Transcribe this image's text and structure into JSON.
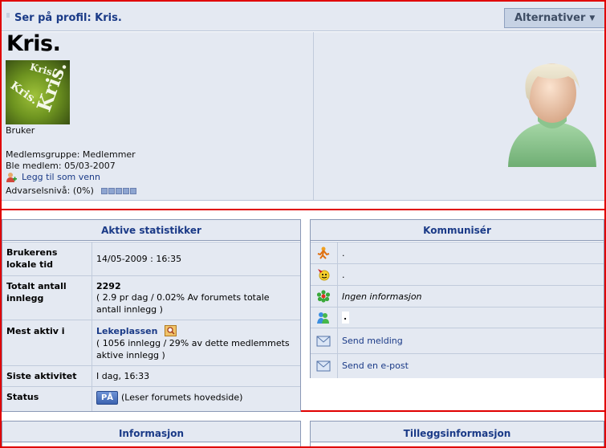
{
  "header": {
    "title": "Ser på profil: Kris.",
    "options_button": "Alternativer"
  },
  "profile": {
    "name": "Kris.",
    "avatar_text": "Kris.",
    "role": "Bruker",
    "group_line": "Medlemsgruppe: Medlemmer",
    "joined_line": "Ble medlem: 05/03-2007",
    "add_friend": "Legg til som venn",
    "warning_line": "Advarselsnivå: (0%)",
    "warning_boxes": 5
  },
  "stats": {
    "title": "Aktive statistikker",
    "local_time_label": "Brukerens lokale tid",
    "local_time_value": "14/05-2009 : 16:35",
    "posts_label": "Totalt antall innlegg",
    "posts_value": "2292",
    "posts_detail": "( 2.9 pr dag / 0.02% Av forumets totale antall innlegg )",
    "most_active_label": "Mest aktiv i",
    "most_active_forum": "Lekeplassen",
    "most_active_detail": "( 1056 innlegg / 29% av dette medlemmets aktive innlegg )",
    "last_activity_label": "Siste aktivitet",
    "last_activity_value": "I dag, 16:33",
    "status_label": "Status",
    "status_badge": "PÅ",
    "status_text": "(Leser forumets hovedside)"
  },
  "communicate": {
    "title": "Kommunisér",
    "rows": [
      {
        "icon": "aim-icon",
        "text": "."
      },
      {
        "icon": "yahoo-icon",
        "text": "."
      },
      {
        "icon": "icq-icon",
        "text": "Ingen informasjon"
      },
      {
        "icon": "msn-icon",
        "text": "."
      },
      {
        "icon": "mail-icon",
        "text": "Send melding"
      },
      {
        "icon": "mail-icon",
        "text": "Send en e-post"
      }
    ]
  },
  "info": {
    "title": "Informasjon"
  },
  "extra": {
    "title": "Tilleggsinformasjon"
  },
  "colors": {
    "accent": "#1a3a87",
    "row_bg": "#e4e9f2",
    "border": "#8b99b6",
    "frame": "#e00000"
  }
}
